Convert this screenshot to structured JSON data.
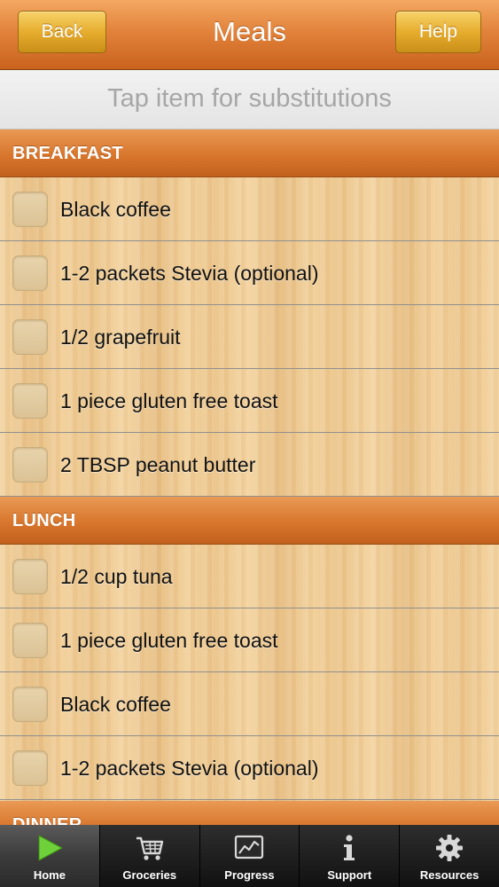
{
  "navbar": {
    "back_label": "Back",
    "title": "Meals",
    "help_label": "Help"
  },
  "subbar": {
    "hint": "Tap item for substitutions"
  },
  "sections": [
    {
      "title": "BREAKFAST",
      "items": [
        "Black coffee",
        "1-2 packets Stevia (optional)",
        "1/2 grapefruit",
        "1 piece gluten free toast",
        "2 TBSP peanut butter"
      ]
    },
    {
      "title": "LUNCH",
      "items": [
        "1/2 cup tuna",
        "1 piece gluten free toast",
        "Black coffee",
        "1-2 packets Stevia (optional)"
      ]
    },
    {
      "title": "DINNER",
      "items": []
    }
  ],
  "tabbar": {
    "tabs": [
      {
        "label": "Home",
        "icon": "play-icon",
        "active": true
      },
      {
        "label": "Groceries",
        "icon": "cart-icon",
        "active": false
      },
      {
        "label": "Progress",
        "icon": "chart-icon",
        "active": false
      },
      {
        "label": "Support",
        "icon": "info-icon",
        "active": false
      },
      {
        "label": "Resources",
        "icon": "gear-icon",
        "active": false
      }
    ]
  },
  "colors": {
    "accent": "#d8762d",
    "button": "#e6ad2e",
    "active_icon": "#6fd13a"
  }
}
